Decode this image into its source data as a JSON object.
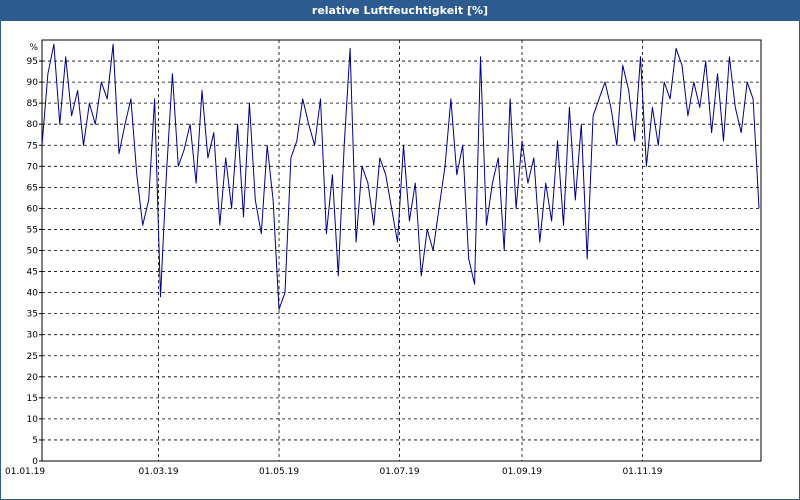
{
  "window": {
    "title": "relative Luftfeuchtigkeit [%]"
  },
  "chart_data": {
    "type": "line",
    "title": "relative Luftfeuchtigkeit [%]",
    "ylabel": "%",
    "ylim": [
      0,
      100
    ],
    "xlim": [
      "2019-01-01",
      "2019-12-31"
    ],
    "grid": true,
    "y_ticks": [
      0,
      5,
      10,
      15,
      20,
      25,
      30,
      35,
      40,
      45,
      50,
      55,
      60,
      65,
      70,
      75,
      80,
      85,
      90,
      95
    ],
    "x_ticks": [
      {
        "label": "01.01.19",
        "date": "2019-01-01"
      },
      {
        "label": "01.03.19",
        "date": "2019-03-01"
      },
      {
        "label": "01.05.19",
        "date": "2019-05-01"
      },
      {
        "label": "01.07.19",
        "date": "2019-07-01"
      },
      {
        "label": "01.09.19",
        "date": "2019-09-01"
      },
      {
        "label": "01.11.19",
        "date": "2019-11-01"
      }
    ],
    "series": [
      {
        "color": "#00008b",
        "x": [
          "2019-01-01",
          "2019-01-04",
          "2019-01-07",
          "2019-01-10",
          "2019-01-13",
          "2019-01-16",
          "2019-01-19",
          "2019-01-22",
          "2019-01-25",
          "2019-01-28",
          "2019-01-31",
          "2019-02-03",
          "2019-02-06",
          "2019-02-09",
          "2019-02-12",
          "2019-02-15",
          "2019-02-18",
          "2019-02-21",
          "2019-02-24",
          "2019-02-27",
          "2019-03-02",
          "2019-03-05",
          "2019-03-08",
          "2019-03-11",
          "2019-03-14",
          "2019-03-17",
          "2019-03-20",
          "2019-03-23",
          "2019-03-26",
          "2019-03-29",
          "2019-04-01",
          "2019-04-04",
          "2019-04-07",
          "2019-04-10",
          "2019-04-13",
          "2019-04-16",
          "2019-04-19",
          "2019-04-22",
          "2019-04-25",
          "2019-04-28",
          "2019-05-01",
          "2019-05-04",
          "2019-05-07",
          "2019-05-10",
          "2019-05-13",
          "2019-05-16",
          "2019-05-19",
          "2019-05-22",
          "2019-05-25",
          "2019-05-28",
          "2019-05-31",
          "2019-06-03",
          "2019-06-06",
          "2019-06-09",
          "2019-06-12",
          "2019-06-15",
          "2019-06-18",
          "2019-06-21",
          "2019-06-24",
          "2019-06-27",
          "2019-06-30",
          "2019-07-03",
          "2019-07-06",
          "2019-07-09",
          "2019-07-12",
          "2019-07-15",
          "2019-07-18",
          "2019-07-21",
          "2019-07-24",
          "2019-07-27",
          "2019-07-30",
          "2019-08-02",
          "2019-08-05",
          "2019-08-08",
          "2019-08-11",
          "2019-08-14",
          "2019-08-17",
          "2019-08-20",
          "2019-08-23",
          "2019-08-26",
          "2019-08-29",
          "2019-09-01",
          "2019-09-04",
          "2019-09-07",
          "2019-09-10",
          "2019-09-13",
          "2019-09-16",
          "2019-09-19",
          "2019-09-22",
          "2019-09-25",
          "2019-09-28",
          "2019-10-01",
          "2019-10-04",
          "2019-10-07",
          "2019-10-10",
          "2019-10-13",
          "2019-10-16",
          "2019-10-19",
          "2019-10-22",
          "2019-10-25",
          "2019-10-28",
          "2019-10-31",
          "2019-11-03",
          "2019-11-06",
          "2019-11-09",
          "2019-11-12",
          "2019-11-15",
          "2019-11-18",
          "2019-11-21",
          "2019-11-24",
          "2019-11-27",
          "2019-11-30",
          "2019-12-03",
          "2019-12-06",
          "2019-12-09",
          "2019-12-12",
          "2019-12-15",
          "2019-12-18",
          "2019-12-21",
          "2019-12-24",
          "2019-12-27",
          "2019-12-30"
        ],
        "values": [
          75,
          92,
          99,
          80,
          96,
          82,
          88,
          75,
          85,
          80,
          90,
          86,
          99,
          73,
          80,
          86,
          68,
          56,
          62,
          86,
          39,
          68,
          92,
          70,
          74,
          80,
          66,
          88,
          72,
          78,
          56,
          72,
          60,
          80,
          58,
          85,
          62,
          54,
          75,
          62,
          36,
          40,
          72,
          76,
          86,
          80,
          75,
          86,
          54,
          68,
          44,
          75,
          98,
          52,
          70,
          66,
          56,
          72,
          68,
          60,
          52,
          75,
          57,
          66,
          44,
          55,
          50,
          60,
          70,
          86,
          68,
          75,
          48,
          42,
          96,
          56,
          66,
          72,
          50,
          86,
          60,
          76,
          66,
          72,
          52,
          66,
          57,
          76,
          56,
          84,
          62,
          80,
          48,
          82,
          86,
          90,
          84,
          75,
          94,
          88,
          76,
          96,
          70,
          84,
          75,
          90,
          86,
          98,
          94,
          82,
          90,
          84,
          95,
          78,
          92,
          76,
          96,
          84,
          78,
          90,
          86,
          60
        ]
      }
    ]
  }
}
